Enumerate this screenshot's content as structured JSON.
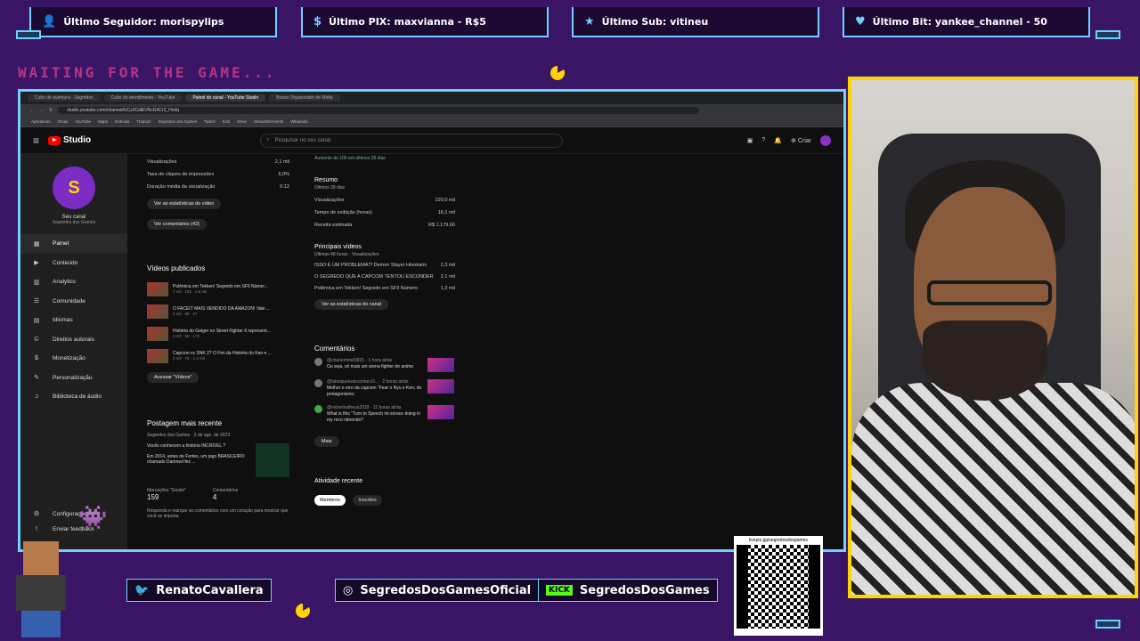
{
  "alerts": [
    {
      "icon": "person-icon",
      "text": "Último Seguidor: morispylips"
    },
    {
      "icon": "dollar-icon",
      "text": "Último PIX: maxvianna - R$5"
    },
    {
      "icon": "star-icon",
      "text": "Último Sub: vitineu"
    },
    {
      "icon": "heart-icon",
      "text": "Último Bit: yankee_channel - 50"
    }
  ],
  "waiting": "WAITING FOR THE GAME...",
  "browser": {
    "tabs": [
      "Cubo de aventura - Segredos",
      "Cubo do atendimento - YouTube",
      "Painel do canal - YouTube Studio",
      "Bossa Organizador de Mídia"
    ],
    "url": "studio.youtube.com/channel/UCz3CdiEVRcG4Cr3_Hmlq",
    "bookmarks": [
      "Aplicativos",
      "Gmail",
      "YouTube",
      "Maps",
      "Notícias",
      "Traduzir",
      "Segredos dos Games",
      "Twitch",
      "Kick",
      "Drive",
      "StreamElements",
      "Wikipedia"
    ]
  },
  "studio": {
    "logo": "Studio",
    "search_placeholder": "Pesquisar no seu canal",
    "create": "Criar",
    "channel_name": "Seu canal",
    "channel_sub": "Segredos dos Games",
    "nav": [
      "Painel",
      "Conteúdo",
      "Analytics",
      "Comunidade",
      "Idiomas",
      "Direitos autorais",
      "Monetização",
      "Personalização",
      "Biblioteca de áudio"
    ],
    "settings": "Configurações",
    "feedback": "Enviar feedback",
    "top_stats": [
      {
        "label": "Visualizações",
        "value": "2,1 mil"
      },
      {
        "label": "Taxa de cliques de impressões",
        "value": "6,0%"
      },
      {
        "label": "Duração média da visualização",
        "value": "6:12"
      }
    ],
    "see_video_stats": "Ver as estatísticas do vídeo",
    "see_comments": "Ver comentários (42)",
    "published_title": "Vídeos publicados",
    "videos": [
      {
        "title": "Polêmica em Tekken! Segredo em SFII Númer...",
        "meta": "7 mil · 192 · 2,6 mil"
      },
      {
        "title": "O FACEIT MAIS VENDIDO DA AMAZON! Vale ...",
        "meta": "2 mil · 80 · 97"
      },
      {
        "title": "História do Gaiger no Street Fighter 6 represent...",
        "meta": "3 mil · 60 · 173"
      },
      {
        "title": "Capcom vs SNK 2? O Fim da História do Ken e ...",
        "meta": "2 mil · 75 · 1,4 mil"
      }
    ],
    "access_videos": "Acessar \"Vídeos\"",
    "post_title": "Postagem mais recente",
    "post_author": "Segredos dos Games · 2 de ago. de 2023",
    "post_text1": "Vocês conhecem a história INCRÍVEL ?",
    "post_text2": "Em 2014, antes de Fortes, um jogo BRASILEIRO chamado Damned fez ...",
    "post_likes_label": "Marcações \"Gostei\"",
    "post_likes": "159",
    "post_comments_label": "Comentários",
    "post_comments": "4",
    "post_reply": "Responda e marque os comentários com um coração para mostrar que você se importa.",
    "top_note": "Aumento de 100 em últimos 28 dias",
    "resumo_title": "Resumo",
    "resumo_sub": "Últimos 28 dias",
    "resumo": [
      {
        "label": "Visualizações",
        "value": "220,0 mil"
      },
      {
        "label": "Tempo de exibição (horas)",
        "value": "16,1 mil"
      },
      {
        "label": "Receita estimada",
        "value": "R$ 1.179,66"
      }
    ],
    "principais_title": "Principais vídeos",
    "principais_sub": "Últimas 48 horas · Visualizações",
    "principais": [
      {
        "label": "ISSO É UM PROBLEMA?! Demon Slayer Hinokami",
        "value": "2,3 mil"
      },
      {
        "label": "O SEGREDO QUE A CAPCOM TENTOU ESCONDER",
        "value": "2,1 mil"
      },
      {
        "label": "Polêmica em Tekken! Segredo em SFII Número",
        "value": "1,3 mil"
      }
    ],
    "see_channel_stats": "Ver as estatísticas do canal",
    "comments_title": "Comentários",
    "comments": [
      {
        "author": "@chaoemmel3831 · 1 hora atrás",
        "text": "Ou seja, só mais um arena fighter de anime"
      },
      {
        "author": "@falsoqueeuteconheci3... · 2 horas atrás",
        "text": "Melhor o erro da capcom \"Fear o Ryu e Ken, do protagonismo."
      },
      {
        "author": "@victormatheus3318 · 11 horas atrás",
        "text": "What is this \"Turn to Speech mi sorace doing in my reco ntinendo?"
      }
    ],
    "more": "Mais",
    "recent_title": "Atividade recente",
    "recent_tabs": [
      "Membros",
      "Inscritos"
    ]
  },
  "socials": [
    {
      "icon": "twitter-icon",
      "text": "RenatoCavallera"
    },
    {
      "icon": "instagram-icon",
      "text": "SegredosDosGamesOficial"
    },
    {
      "icon": "kick-icon",
      "badge": "KICK",
      "text": "SegredosDosGames"
    }
  ],
  "qr_caption": "livepix.gg/segredosdosgames",
  "colors": {
    "accent": "#6fd0ff",
    "frame": "#ffd400",
    "bg": "#3a1566",
    "pink": "#e0418f"
  }
}
